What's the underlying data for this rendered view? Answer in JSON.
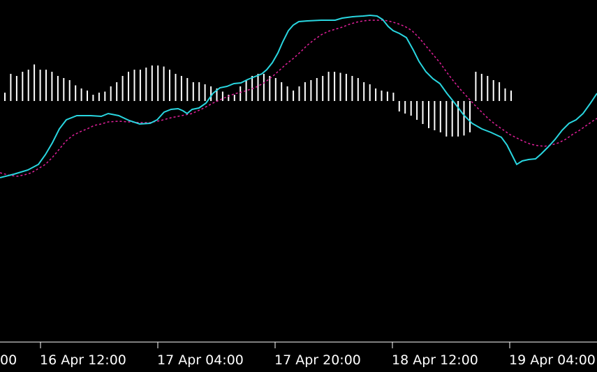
{
  "chart_data": {
    "type": "line",
    "indicator": "MACD",
    "x_tick_labels": [
      "16 Apr 12:00",
      "17 Apr 04:00",
      "17 Apr 20:00",
      "18 Apr 12:00",
      "19 Apr 04:00"
    ],
    "zero_line_visible": false,
    "grid": false,
    "legend": "none",
    "colors": {
      "background": "#000000",
      "macd_line": "#29d6e0",
      "signal_line": "#e0209a",
      "histogram": "#ffffff",
      "axis": "#ffffff",
      "text": "#ffffff"
    },
    "histogram": [
      0.08,
      0.26,
      0.24,
      0.28,
      0.3,
      0.35,
      0.3,
      0.3,
      0.28,
      0.24,
      0.22,
      0.2,
      0.15,
      0.12,
      0.1,
      0.06,
      0.08,
      0.09,
      0.14,
      0.18,
      0.24,
      0.28,
      0.3,
      0.3,
      0.32,
      0.34,
      0.34,
      0.33,
      0.3,
      0.26,
      0.24,
      0.22,
      0.18,
      0.18,
      0.16,
      0.14,
      0.12,
      0.09,
      0.06,
      0.06,
      0.14,
      0.2,
      0.24,
      0.26,
      0.26,
      0.24,
      0.22,
      0.18,
      0.14,
      0.1,
      0.14,
      0.18,
      0.2,
      0.22,
      0.24,
      0.28,
      0.28,
      0.27,
      0.26,
      0.24,
      0.22,
      0.18,
      0.16,
      0.12,
      0.1,
      0.09,
      0.08,
      0.1,
      0.12,
      0.14,
      0.18,
      0.22,
      0.26,
      0.28,
      0.3,
      0.34,
      0.34,
      0.34,
      0.33,
      0.3,
      0.28,
      0.26,
      0.24,
      0.2,
      0.18,
      0.12,
      0.1
    ],
    "macd_line": [
      [
        0,
        255
      ],
      [
        20,
        250
      ],
      [
        40,
        244
      ],
      [
        55,
        236
      ],
      [
        65,
        222
      ],
      [
        75,
        205
      ],
      [
        85,
        185
      ],
      [
        95,
        172
      ],
      [
        110,
        166
      ],
      [
        130,
        166
      ],
      [
        145,
        167
      ],
      [
        155,
        163
      ],
      [
        170,
        166
      ],
      [
        185,
        173
      ],
      [
        200,
        178
      ],
      [
        215,
        177
      ],
      [
        225,
        172
      ],
      [
        235,
        161
      ],
      [
        245,
        157
      ],
      [
        255,
        156
      ],
      [
        262,
        159
      ],
      [
        268,
        163
      ],
      [
        275,
        157
      ],
      [
        285,
        155
      ],
      [
        295,
        148
      ],
      [
        305,
        134
      ],
      [
        315,
        126
      ],
      [
        325,
        124
      ],
      [
        335,
        120
      ],
      [
        345,
        119
      ],
      [
        355,
        114
      ],
      [
        365,
        110
      ],
      [
        375,
        106
      ],
      [
        382,
        100
      ],
      [
        390,
        90
      ],
      [
        398,
        76
      ],
      [
        405,
        60
      ],
      [
        413,
        44
      ],
      [
        420,
        36
      ],
      [
        428,
        31
      ],
      [
        440,
        30
      ],
      [
        460,
        29
      ],
      [
        480,
        29
      ],
      [
        490,
        26
      ],
      [
        505,
        24
      ],
      [
        520,
        23
      ],
      [
        530,
        22
      ],
      [
        540,
        23
      ],
      [
        548,
        28
      ],
      [
        556,
        38
      ],
      [
        563,
        44
      ],
      [
        572,
        48
      ],
      [
        582,
        54
      ],
      [
        592,
        72
      ],
      [
        600,
        88
      ],
      [
        610,
        103
      ],
      [
        620,
        113
      ],
      [
        630,
        120
      ],
      [
        640,
        134
      ],
      [
        652,
        149
      ],
      [
        664,
        165
      ],
      [
        676,
        177
      ],
      [
        690,
        185
      ],
      [
        703,
        190
      ],
      [
        718,
        197
      ],
      [
        726,
        208
      ],
      [
        733,
        222
      ],
      [
        740,
        236
      ],
      [
        748,
        231
      ],
      [
        757,
        229
      ],
      [
        767,
        228
      ],
      [
        775,
        221
      ],
      [
        785,
        211
      ],
      [
        795,
        200
      ],
      [
        805,
        187
      ],
      [
        815,
        177
      ],
      [
        825,
        172
      ],
      [
        835,
        163
      ],
      [
        845,
        149
      ],
      [
        855,
        134
      ]
    ],
    "signal_line": [
      [
        0,
        248
      ],
      [
        15,
        252
      ],
      [
        25,
        253
      ],
      [
        35,
        251
      ],
      [
        45,
        248
      ],
      [
        55,
        242
      ],
      [
        65,
        236
      ],
      [
        75,
        226
      ],
      [
        85,
        214
      ],
      [
        95,
        202
      ],
      [
        105,
        194
      ],
      [
        115,
        189
      ],
      [
        125,
        185
      ],
      [
        135,
        180
      ],
      [
        145,
        178
      ],
      [
        155,
        175
      ],
      [
        170,
        174
      ],
      [
        185,
        175
      ],
      [
        200,
        176
      ],
      [
        215,
        176
      ],
      [
        230,
        173
      ],
      [
        245,
        169
      ],
      [
        260,
        166
      ],
      [
        275,
        163
      ],
      [
        290,
        156
      ],
      [
        305,
        148
      ],
      [
        320,
        141
      ],
      [
        335,
        135
      ],
      [
        350,
        131
      ],
      [
        365,
        126
      ],
      [
        378,
        119
      ],
      [
        390,
        110
      ],
      [
        400,
        101
      ],
      [
        410,
        92
      ],
      [
        420,
        84
      ],
      [
        430,
        75
      ],
      [
        440,
        65
      ],
      [
        450,
        57
      ],
      [
        460,
        50
      ],
      [
        470,
        45
      ],
      [
        480,
        42
      ],
      [
        490,
        39
      ],
      [
        500,
        35
      ],
      [
        510,
        32
      ],
      [
        520,
        30
      ],
      [
        530,
        29
      ],
      [
        540,
        29
      ],
      [
        550,
        29
      ],
      [
        560,
        31
      ],
      [
        570,
        34
      ],
      [
        580,
        38
      ],
      [
        590,
        44
      ],
      [
        600,
        54
      ],
      [
        610,
        66
      ],
      [
        620,
        78
      ],
      [
        630,
        90
      ],
      [
        640,
        104
      ],
      [
        650,
        117
      ],
      [
        660,
        129
      ],
      [
        670,
        140
      ],
      [
        680,
        151
      ],
      [
        690,
        161
      ],
      [
        700,
        171
      ],
      [
        710,
        179
      ],
      [
        720,
        186
      ],
      [
        730,
        193
      ],
      [
        740,
        198
      ],
      [
        750,
        203
      ],
      [
        760,
        207
      ],
      [
        770,
        209
      ],
      [
        780,
        210
      ],
      [
        790,
        208
      ],
      [
        800,
        205
      ],
      [
        810,
        200
      ],
      [
        820,
        193
      ],
      [
        830,
        187
      ],
      [
        840,
        180
      ],
      [
        850,
        173
      ],
      [
        855,
        170
      ]
    ]
  }
}
